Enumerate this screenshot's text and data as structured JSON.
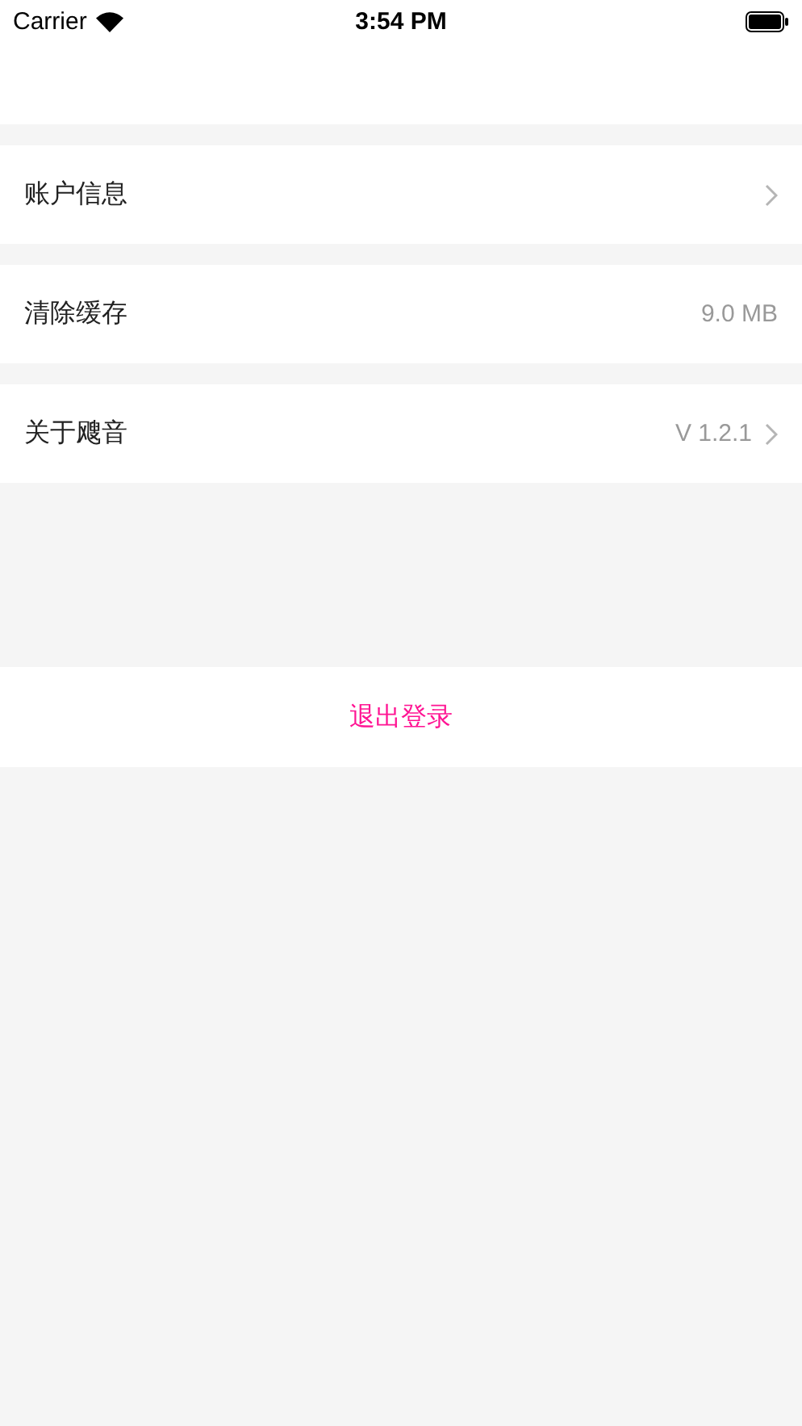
{
  "status_bar": {
    "carrier": "Carrier",
    "time": "3:54 PM"
  },
  "rows": [
    {
      "label": "账户信息",
      "chevron": true
    },
    {
      "label": "清除缓存",
      "value": "9.0 MB",
      "chevron": false
    },
    {
      "label": "关于飕音",
      "value": "V 1.2.1",
      "chevron": true
    }
  ],
  "logout": {
    "label": "退出登录"
  }
}
